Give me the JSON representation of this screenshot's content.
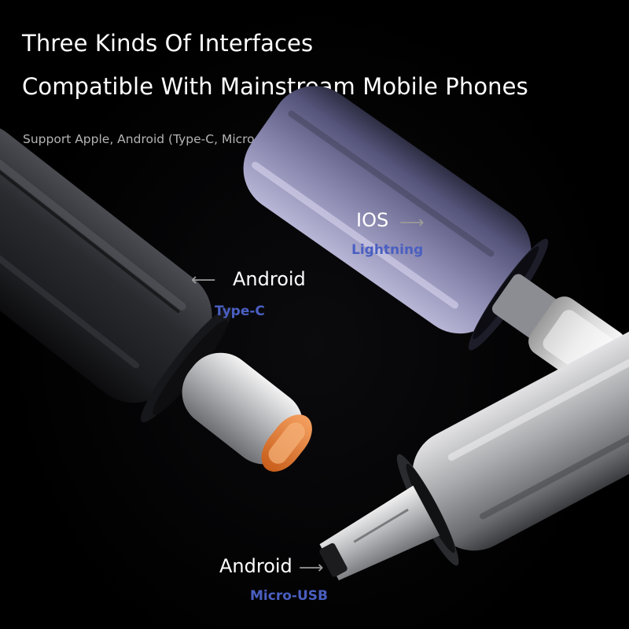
{
  "heading": {
    "line1": "Three Kinds Of Interfaces",
    "line2": "Compatible With Mainstream Mobile Phones",
    "subtitle": "Support Apple, Android (Type-C, Micro USB) interface"
  },
  "connectors": {
    "ios": {
      "label": "IOS",
      "type": "Lightning"
    },
    "typec": {
      "label": "Android",
      "type": "Type-C"
    },
    "micro": {
      "label": "Android",
      "type": "Micro-USB"
    }
  },
  "colors": {
    "background": "#000000",
    "heading": "#ffffff",
    "subtitle": "#b4b4b4",
    "type_label": "#4a5fc1",
    "arrow": "#9a9a9a",
    "typec_port": "#e07a2c"
  },
  "icons": [
    "arrow-right-icon",
    "arrow-left-icon"
  ]
}
